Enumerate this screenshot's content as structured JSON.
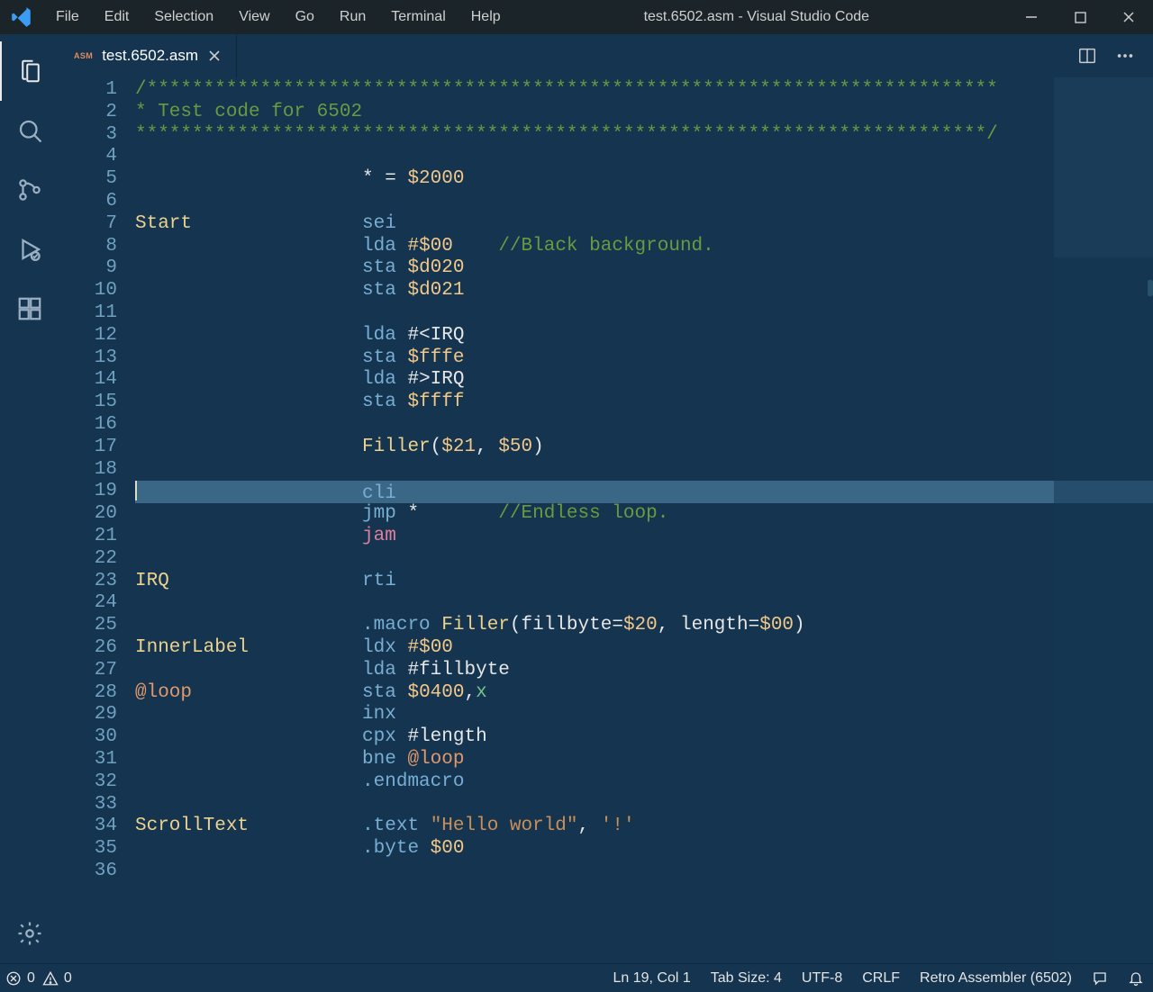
{
  "window": {
    "title": "test.6502.asm - Visual Studio Code",
    "menu": [
      "File",
      "Edit",
      "Selection",
      "View",
      "Go",
      "Run",
      "Terminal",
      "Help"
    ]
  },
  "tabs": [
    {
      "lang_badge": "ASM",
      "filename": "test.6502.asm",
      "dirty": false,
      "active": true
    }
  ],
  "activitybar": {
    "items": [
      "explorer",
      "search",
      "scm",
      "debug",
      "extensions"
    ],
    "bottom": [
      "settings"
    ]
  },
  "editor": {
    "cursor_line": 19,
    "line_count": 36,
    "lines": [
      {
        "n": 1,
        "seg": [
          {
            "cls": "c-comment",
            "t": "/***************************************************************************"
          }
        ]
      },
      {
        "n": 2,
        "seg": [
          {
            "cls": "c-comment",
            "t": "* Test code for 6502"
          }
        ]
      },
      {
        "n": 3,
        "seg": [
          {
            "cls": "c-comment",
            "t": "***************************************************************************/"
          }
        ]
      },
      {
        "n": 4,
        "seg": []
      },
      {
        "n": 5,
        "seg": [
          {
            "cls": "c-default",
            "t": "                    * = "
          },
          {
            "cls": "c-number",
            "t": "$2000"
          }
        ]
      },
      {
        "n": 6,
        "seg": []
      },
      {
        "n": 7,
        "seg": [
          {
            "cls": "c-label",
            "t": "Start"
          },
          {
            "cls": "c-default",
            "t": "               "
          },
          {
            "cls": "c-mnemonic",
            "t": "sei"
          }
        ]
      },
      {
        "n": 8,
        "seg": [
          {
            "cls": "c-default",
            "t": "                    "
          },
          {
            "cls": "c-mnemonic",
            "t": "lda"
          },
          {
            "cls": "c-default",
            "t": " "
          },
          {
            "cls": "c-number",
            "t": "#$00"
          },
          {
            "cls": "c-default",
            "t": "    "
          },
          {
            "cls": "c-comment",
            "t": "//Black background."
          }
        ]
      },
      {
        "n": 9,
        "seg": [
          {
            "cls": "c-default",
            "t": "                    "
          },
          {
            "cls": "c-mnemonic",
            "t": "sta"
          },
          {
            "cls": "c-default",
            "t": " "
          },
          {
            "cls": "c-number",
            "t": "$d020"
          }
        ]
      },
      {
        "n": 10,
        "seg": [
          {
            "cls": "c-default",
            "t": "                    "
          },
          {
            "cls": "c-mnemonic",
            "t": "sta"
          },
          {
            "cls": "c-default",
            "t": " "
          },
          {
            "cls": "c-number",
            "t": "$d021"
          }
        ]
      },
      {
        "n": 11,
        "seg": []
      },
      {
        "n": 12,
        "seg": [
          {
            "cls": "c-default",
            "t": "                    "
          },
          {
            "cls": "c-mnemonic",
            "t": "lda"
          },
          {
            "cls": "c-default",
            "t": " #<"
          },
          {
            "cls": "c-ident",
            "t": "IRQ"
          }
        ]
      },
      {
        "n": 13,
        "seg": [
          {
            "cls": "c-default",
            "t": "                    "
          },
          {
            "cls": "c-mnemonic",
            "t": "sta"
          },
          {
            "cls": "c-default",
            "t": " "
          },
          {
            "cls": "c-number",
            "t": "$fffe"
          }
        ]
      },
      {
        "n": 14,
        "seg": [
          {
            "cls": "c-default",
            "t": "                    "
          },
          {
            "cls": "c-mnemonic",
            "t": "lda"
          },
          {
            "cls": "c-default",
            "t": " #>"
          },
          {
            "cls": "c-ident",
            "t": "IRQ"
          }
        ]
      },
      {
        "n": 15,
        "seg": [
          {
            "cls": "c-default",
            "t": "                    "
          },
          {
            "cls": "c-mnemonic",
            "t": "sta"
          },
          {
            "cls": "c-default",
            "t": " "
          },
          {
            "cls": "c-number",
            "t": "$ffff"
          }
        ]
      },
      {
        "n": 16,
        "seg": []
      },
      {
        "n": 17,
        "seg": [
          {
            "cls": "c-default",
            "t": "                    "
          },
          {
            "cls": "c-label",
            "t": "Filler"
          },
          {
            "cls": "c-default",
            "t": "("
          },
          {
            "cls": "c-number",
            "t": "$21"
          },
          {
            "cls": "c-default",
            "t": ", "
          },
          {
            "cls": "c-number",
            "t": "$50"
          },
          {
            "cls": "c-default",
            "t": ")"
          }
        ]
      },
      {
        "n": 18,
        "seg": []
      },
      {
        "n": 19,
        "seg": [
          {
            "cls": "c-default",
            "t": "                    "
          },
          {
            "cls": "c-mnemonic",
            "t": "cli"
          }
        ]
      },
      {
        "n": 20,
        "seg": [
          {
            "cls": "c-default",
            "t": "                    "
          },
          {
            "cls": "c-mnemonic",
            "t": "jmp"
          },
          {
            "cls": "c-default",
            "t": " *       "
          },
          {
            "cls": "c-comment",
            "t": "//Endless loop."
          }
        ]
      },
      {
        "n": 21,
        "seg": [
          {
            "cls": "c-default",
            "t": "                    "
          },
          {
            "cls": "c-error",
            "t": "jam"
          }
        ]
      },
      {
        "n": 22,
        "seg": []
      },
      {
        "n": 23,
        "seg": [
          {
            "cls": "c-label",
            "t": "IRQ"
          },
          {
            "cls": "c-default",
            "t": "                 "
          },
          {
            "cls": "c-mnemonic",
            "t": "rti"
          }
        ]
      },
      {
        "n": 24,
        "seg": []
      },
      {
        "n": 25,
        "seg": [
          {
            "cls": "c-default",
            "t": "                    "
          },
          {
            "cls": "c-directive",
            "t": ".macro"
          },
          {
            "cls": "c-default",
            "t": " "
          },
          {
            "cls": "c-label",
            "t": "Filler"
          },
          {
            "cls": "c-default",
            "t": "("
          },
          {
            "cls": "c-ident",
            "t": "fillbyte"
          },
          {
            "cls": "c-default",
            "t": "="
          },
          {
            "cls": "c-number",
            "t": "$20"
          },
          {
            "cls": "c-default",
            "t": ", "
          },
          {
            "cls": "c-ident",
            "t": "length"
          },
          {
            "cls": "c-default",
            "t": "="
          },
          {
            "cls": "c-number",
            "t": "$00"
          },
          {
            "cls": "c-default",
            "t": ")"
          }
        ]
      },
      {
        "n": 26,
        "seg": [
          {
            "cls": "c-label",
            "t": "InnerLabel"
          },
          {
            "cls": "c-default",
            "t": "          "
          },
          {
            "cls": "c-mnemonic",
            "t": "ldx"
          },
          {
            "cls": "c-default",
            "t": " "
          },
          {
            "cls": "c-number",
            "t": "#$00"
          }
        ]
      },
      {
        "n": 27,
        "seg": [
          {
            "cls": "c-default",
            "t": "                    "
          },
          {
            "cls": "c-mnemonic",
            "t": "lda"
          },
          {
            "cls": "c-default",
            "t": " #"
          },
          {
            "cls": "c-ident",
            "t": "fillbyte"
          }
        ]
      },
      {
        "n": 28,
        "seg": [
          {
            "cls": "c-atlabel",
            "t": "@loop"
          },
          {
            "cls": "c-default",
            "t": "               "
          },
          {
            "cls": "c-mnemonic",
            "t": "sta"
          },
          {
            "cls": "c-default",
            "t": " "
          },
          {
            "cls": "c-number",
            "t": "$0400"
          },
          {
            "cls": "c-default",
            "t": ","
          },
          {
            "cls": "c-register",
            "t": "x"
          }
        ]
      },
      {
        "n": 29,
        "seg": [
          {
            "cls": "c-default",
            "t": "                    "
          },
          {
            "cls": "c-mnemonic",
            "t": "inx"
          }
        ]
      },
      {
        "n": 30,
        "seg": [
          {
            "cls": "c-default",
            "t": "                    "
          },
          {
            "cls": "c-mnemonic",
            "t": "cpx"
          },
          {
            "cls": "c-default",
            "t": " #"
          },
          {
            "cls": "c-ident",
            "t": "length"
          }
        ]
      },
      {
        "n": 31,
        "seg": [
          {
            "cls": "c-default",
            "t": "                    "
          },
          {
            "cls": "c-mnemonic",
            "t": "bne"
          },
          {
            "cls": "c-default",
            "t": " "
          },
          {
            "cls": "c-atlabel",
            "t": "@loop"
          }
        ]
      },
      {
        "n": 32,
        "seg": [
          {
            "cls": "c-default",
            "t": "                    "
          },
          {
            "cls": "c-directive",
            "t": ".endmacro"
          }
        ]
      },
      {
        "n": 33,
        "seg": []
      },
      {
        "n": 34,
        "seg": [
          {
            "cls": "c-label",
            "t": "ScrollText"
          },
          {
            "cls": "c-default",
            "t": "          "
          },
          {
            "cls": "c-directive",
            "t": ".text"
          },
          {
            "cls": "c-default",
            "t": " "
          },
          {
            "cls": "c-string",
            "t": "\"Hello world\""
          },
          {
            "cls": "c-default",
            "t": ", "
          },
          {
            "cls": "c-string",
            "t": "'!'"
          }
        ]
      },
      {
        "n": 35,
        "seg": [
          {
            "cls": "c-default",
            "t": "                    "
          },
          {
            "cls": "c-directive",
            "t": ".byte"
          },
          {
            "cls": "c-default",
            "t": " "
          },
          {
            "cls": "c-number",
            "t": "$00"
          }
        ]
      },
      {
        "n": 36,
        "seg": []
      }
    ]
  },
  "statusbar": {
    "errors": "0",
    "warnings": "0",
    "position": "Ln 19, Col 1",
    "tabsize": "Tab Size: 4",
    "encoding": "UTF-8",
    "eol": "CRLF",
    "language": "Retro Assembler (6502)"
  }
}
